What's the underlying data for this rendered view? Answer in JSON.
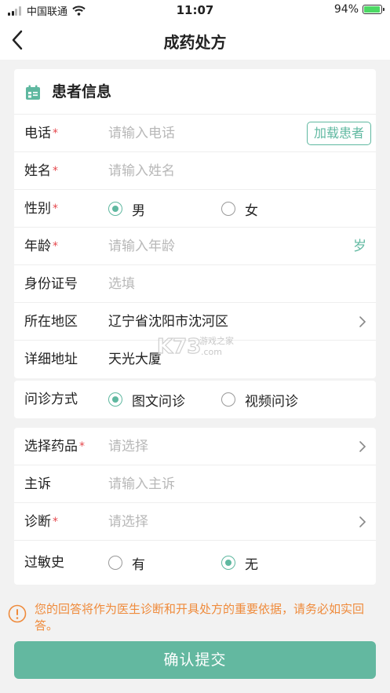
{
  "status_bar": {
    "carrier": "中国联通",
    "time": "11:07",
    "battery": "94%",
    "battery_level": 0.94
  },
  "nav": {
    "title": "成药处方"
  },
  "patient": {
    "section_title": "患者信息",
    "phone": {
      "label": "电话",
      "required_mark": "*",
      "placeholder": "请输入电话",
      "load_button": "加载患者"
    },
    "name": {
      "label": "姓名",
      "required_mark": "*",
      "placeholder": "请输入姓名"
    },
    "gender": {
      "label": "性别",
      "required_mark": "*",
      "options": [
        "男",
        "女"
      ],
      "selected": "男"
    },
    "age": {
      "label": "年龄",
      "required_mark": "*",
      "placeholder": "请输入年龄",
      "unit": "岁"
    },
    "id_number": {
      "label": "身份证号",
      "placeholder": "选填"
    },
    "region": {
      "label": "所在地区",
      "value": "辽宁省沈阳市沈河区"
    },
    "address": {
      "label": "详细地址",
      "value": "天光大厦"
    }
  },
  "consult": {
    "label": "问诊方式",
    "options": [
      "图文问诊",
      "视频问诊"
    ],
    "selected": "图文问诊"
  },
  "prescription": {
    "drug": {
      "label": "选择药品",
      "required_mark": "*",
      "placeholder": "请选择"
    },
    "complaint": {
      "label": "主诉",
      "placeholder": "请输入主诉"
    },
    "diagnosis": {
      "label": "诊断",
      "required_mark": "*",
      "placeholder": "请选择"
    },
    "allergy": {
      "label": "过敏史",
      "options": [
        "有",
        "无"
      ],
      "selected": "无"
    }
  },
  "watermark": {
    "brand": "K73",
    "text1": "游戏之家",
    "text2": ".com"
  },
  "notice": "您的回答将作为医生诊断和开具处方的重要依据，请务必如实回答。",
  "submit_label": "确认提交",
  "colors": {
    "accent": "#63b8a0",
    "required": "#e5484d",
    "warning": "#ef8b3c"
  }
}
